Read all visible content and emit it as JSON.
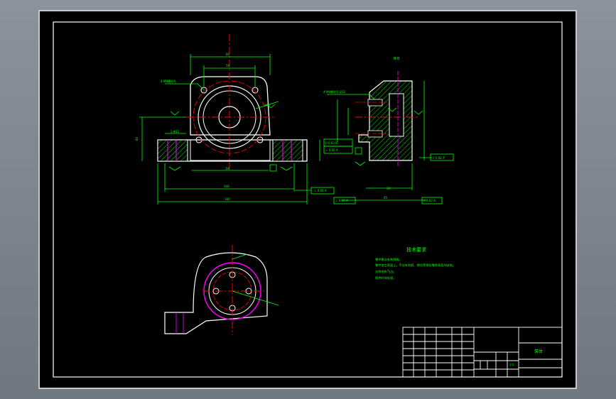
{
  "drawing": {
    "section_label": "B-B",
    "tech_requirements": {
      "heading": "技术要求",
      "items": [
        "零件需去毛刺倒角。",
        "零件加工表面上，不应有划痕、擦伤等损伤零件表面的缺陷。",
        "去除毛刺飞边。",
        "铸件时效处理。"
      ]
    },
    "title_block": {
      "part_name": "泵体",
      "scale": "1:1"
    },
    "colors": {
      "paper": "#000000",
      "outline": "#ffffff",
      "dimension": "#00ff00",
      "centerline": "#ff0000",
      "hidden": "#ff00ff",
      "hatch": "#00ff00"
    }
  }
}
